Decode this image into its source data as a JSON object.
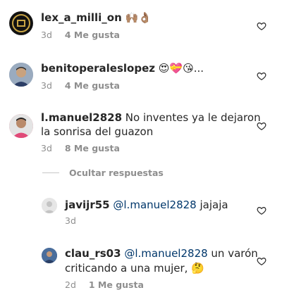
{
  "comments": [
    {
      "username": "lex_a_milli_on",
      "text": "",
      "emoji": "🙌🏽👌🏽",
      "time": "3d",
      "likes": "4 Me gusta"
    },
    {
      "username": "benitoperaleslopez",
      "text": "",
      "emoji": "😍💝😘...",
      "time": "3d",
      "likes": "4 Me gusta"
    },
    {
      "username": "l.manuel2828",
      "text": "No inventes ya le dejaron",
      "text_line2": "la sonrisa del guazon",
      "time": "3d",
      "likes": "8 Me gusta"
    }
  ],
  "hide_replies_label": "Ocultar respuestas",
  "replies": [
    {
      "username": "javijr55",
      "mention": "@l.manuel2828",
      "text": " jajaja",
      "time": "3d",
      "likes": ""
    },
    {
      "username": "clau_rs03",
      "mention": "@l.manuel2828",
      "text": " un varón",
      "text_line2": "criticando a una mujer, ",
      "emoji_line2": "🤔",
      "time": "2d",
      "likes": "1 Me gusta"
    }
  ],
  "icons": {
    "like": "heart-outline-icon"
  }
}
